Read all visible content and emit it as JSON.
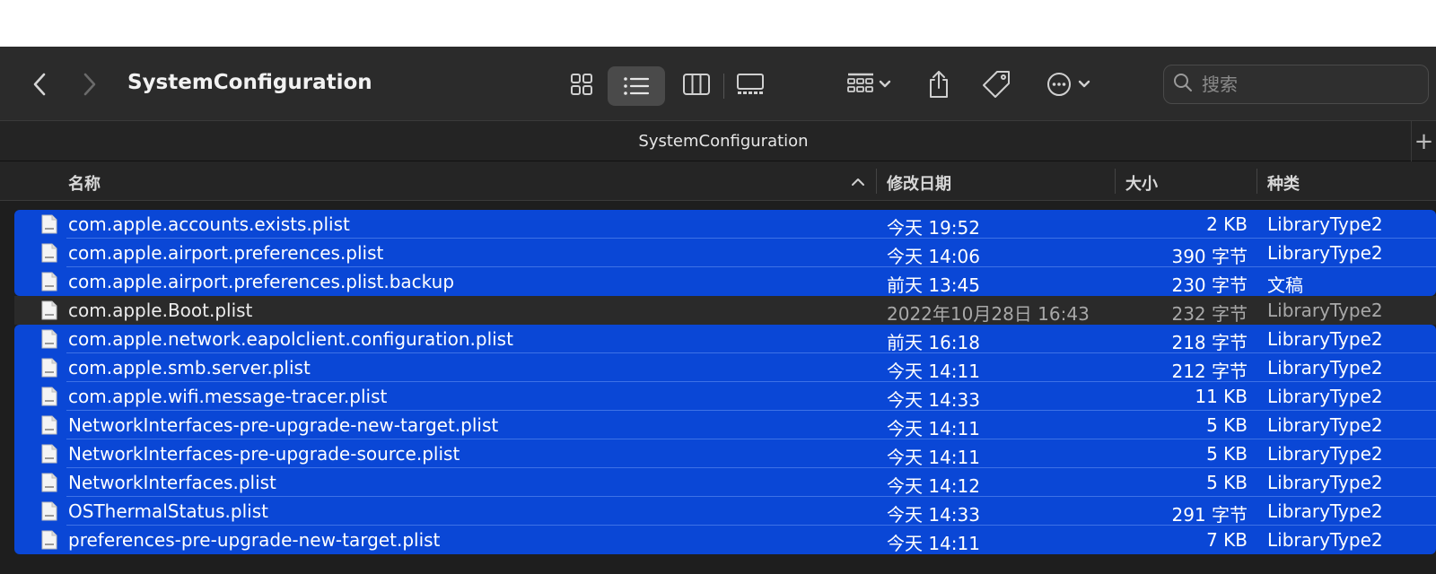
{
  "window": {
    "title": "SystemConfiguration",
    "tab_title": "SystemConfiguration",
    "tab_add_label": "+"
  },
  "search": {
    "placeholder": "搜索",
    "value": ""
  },
  "columns": {
    "name": "名称",
    "date": "修改日期",
    "size": "大小",
    "kind": "种类"
  },
  "icons": {
    "back": "chevron-left-icon",
    "forward": "chevron-right-icon",
    "view_icon": "icon-grid-view-icon",
    "view_list": "list-view-icon",
    "view_column": "column-view-icon",
    "view_gallery": "gallery-view-icon",
    "group": "group-by-icon",
    "share": "share-icon",
    "tag": "tag-icon",
    "more": "ellipsis-circle-icon",
    "search": "search-icon",
    "file": "plist-file-icon"
  },
  "colors": {
    "selection": "#0a47d6",
    "window_bg": "#1e1e1e",
    "toolbar_bg": "#2b2b2b"
  },
  "files": [
    {
      "name": "com.apple.accounts.exists.plist",
      "date": "今天 19:52",
      "size": "2 KB",
      "kind": "LibraryType2",
      "selected": true
    },
    {
      "name": "com.apple.airport.preferences.plist",
      "date": "今天 14:06",
      "size": "390 字节",
      "kind": "LibraryType2",
      "selected": true
    },
    {
      "name": "com.apple.airport.preferences.plist.backup",
      "date": "前天 13:45",
      "size": "230 字节",
      "kind": "文稿",
      "selected": true
    },
    {
      "name": "com.apple.Boot.plist",
      "date": "2022年10月28日 16:43",
      "size": "232 字节",
      "kind": "LibraryType2",
      "selected": false
    },
    {
      "name": "com.apple.network.eapolclient.configuration.plist",
      "date": "前天 16:18",
      "size": "218 字节",
      "kind": "LibraryType2",
      "selected": true
    },
    {
      "name": "com.apple.smb.server.plist",
      "date": "今天 14:11",
      "size": "212 字节",
      "kind": "LibraryType2",
      "selected": true
    },
    {
      "name": "com.apple.wifi.message-tracer.plist",
      "date": "今天 14:33",
      "size": "11 KB",
      "kind": "LibraryType2",
      "selected": true
    },
    {
      "name": "NetworkInterfaces-pre-upgrade-new-target.plist",
      "date": "今天 14:11",
      "size": "5 KB",
      "kind": "LibraryType2",
      "selected": true
    },
    {
      "name": "NetworkInterfaces-pre-upgrade-source.plist",
      "date": "今天 14:11",
      "size": "5 KB",
      "kind": "LibraryType2",
      "selected": true
    },
    {
      "name": "NetworkInterfaces.plist",
      "date": "今天 14:12",
      "size": "5 KB",
      "kind": "LibraryType2",
      "selected": true
    },
    {
      "name": "OSThermalStatus.plist",
      "date": "今天 14:33",
      "size": "291 字节",
      "kind": "LibraryType2",
      "selected": true
    },
    {
      "name": "preferences-pre-upgrade-new-target.plist",
      "date": "今天 14:11",
      "size": "7 KB",
      "kind": "LibraryType2",
      "selected": true
    }
  ]
}
